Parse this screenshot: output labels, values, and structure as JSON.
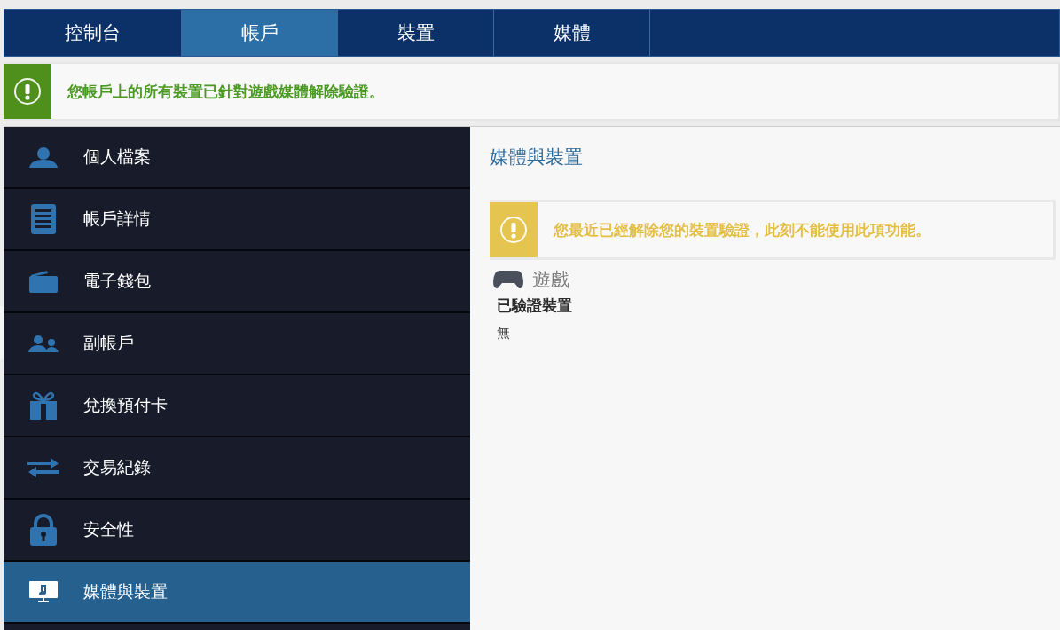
{
  "tabs": [
    {
      "label": "控制台",
      "selected": false
    },
    {
      "label": "帳戶",
      "selected": true
    },
    {
      "label": "裝置",
      "selected": false
    },
    {
      "label": "媒體",
      "selected": false
    }
  ],
  "notice": {
    "kind": "success",
    "text": "您帳戶上的所有裝置已針對遊戲媒體解除驗證。"
  },
  "sidebar": {
    "items": [
      {
        "label": "個人檔案",
        "kind": "person",
        "selected": false
      },
      {
        "label": "帳戶詳情",
        "kind": "details",
        "selected": false
      },
      {
        "label": "電子錢包",
        "kind": "wallet",
        "selected": false
      },
      {
        "label": "副帳戶",
        "kind": "people",
        "selected": false
      },
      {
        "label": "兌換預付卡",
        "kind": "gift",
        "selected": false
      },
      {
        "label": "交易紀錄",
        "kind": "arrows",
        "selected": false
      },
      {
        "label": "安全性",
        "kind": "lock",
        "selected": false
      },
      {
        "label": "媒體與裝置",
        "kind": "monitor",
        "selected": true
      }
    ]
  },
  "content": {
    "title": "媒體與裝置",
    "warning": {
      "kind": "warning",
      "text": "您最近已經解除您的裝置驗證，此刻不能使用此項功能。"
    },
    "section": {
      "title": "遊戲",
      "subtitle": "已驗證裝置",
      "value": "無"
    }
  }
}
